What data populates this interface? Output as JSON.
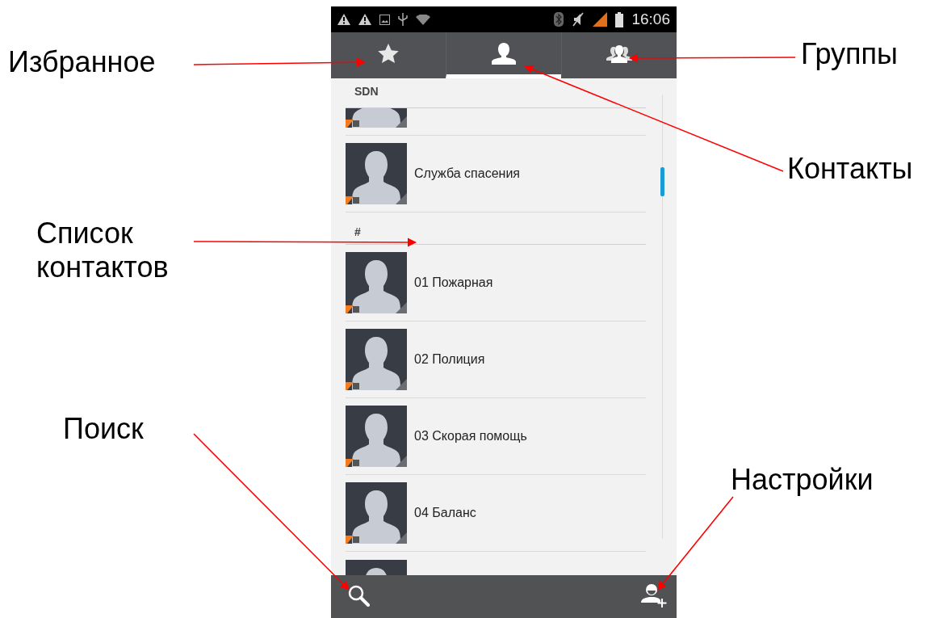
{
  "annotations": [
    {
      "label": "Избранное"
    },
    {
      "label": "Группы"
    },
    {
      "label": "Контакты"
    },
    {
      "label": "Список контактов"
    },
    {
      "label": "Поиск"
    },
    {
      "label": "Настройки"
    }
  ],
  "status_bar": {
    "time": "16:06"
  },
  "tabs": [
    {
      "kind": "star",
      "selected": false
    },
    {
      "kind": "person",
      "selected": true
    },
    {
      "kind": "group",
      "selected": false
    }
  ],
  "list": [
    {
      "kind": "header",
      "text": "SDN"
    },
    {
      "kind": "contact-cut-top"
    },
    {
      "kind": "contact",
      "name": "Служба спасения"
    },
    {
      "kind": "header",
      "text": "#"
    },
    {
      "kind": "contact",
      "name": "01 Пожарная"
    },
    {
      "kind": "contact",
      "name": "02 Полиция"
    },
    {
      "kind": "contact",
      "name": "03 Скорая помощь"
    },
    {
      "kind": "contact",
      "name": "04 Баланс"
    },
    {
      "kind": "contact-cut-bottom"
    }
  ],
  "bottom_bar": {
    "buttons": [
      {
        "kind": "search"
      },
      {
        "kind": "add-contact"
      }
    ]
  }
}
